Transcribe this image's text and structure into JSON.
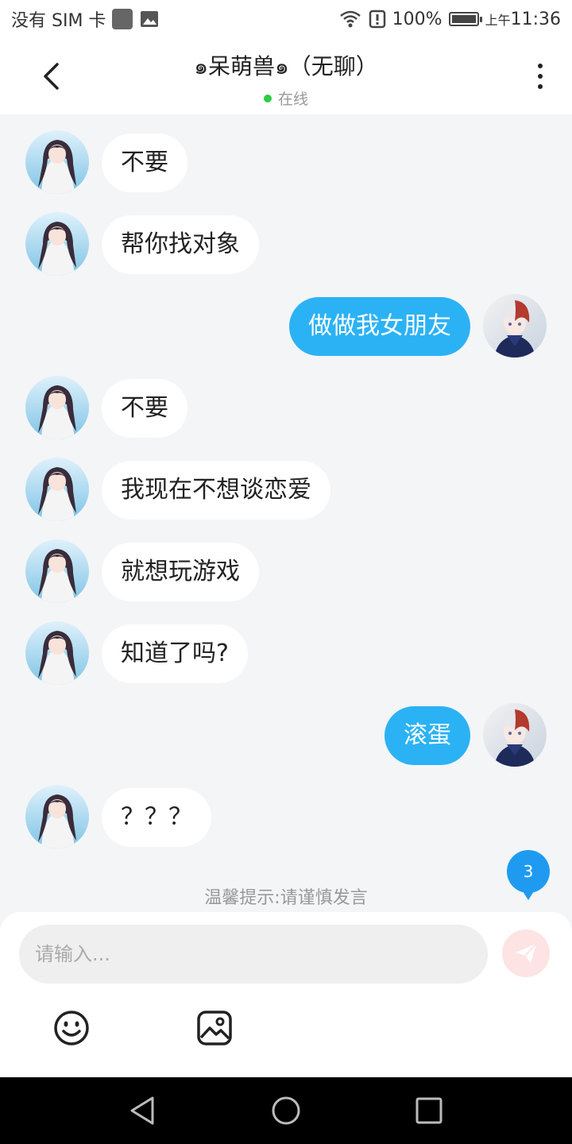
{
  "status_bar": {
    "carrier": "没有 SIM 卡",
    "battery": "100%",
    "battery_level": 1.0,
    "time_prefix": "上午",
    "time": "11:36"
  },
  "header": {
    "title": "๑呆萌兽๑（无聊）",
    "presence": "在线",
    "presence_color": "#2ecc40"
  },
  "messages": [
    {
      "side": "in",
      "text": "不要"
    },
    {
      "side": "in",
      "text": "帮你找对象"
    },
    {
      "side": "out",
      "text": "做做我女朋友"
    },
    {
      "side": "in",
      "text": "不要"
    },
    {
      "side": "in",
      "text": "我现在不想谈恋爱"
    },
    {
      "side": "in",
      "text": "就想玩游戏"
    },
    {
      "side": "in",
      "text": "知道了吗?"
    },
    {
      "side": "out",
      "text": "滚蛋"
    },
    {
      "side": "in",
      "text": "？？？"
    }
  ],
  "unread_count": "3",
  "tip": "温馨提示:请谨慎发言",
  "composer": {
    "placeholder": "请输入..."
  },
  "colors": {
    "outgoing_bubble": "#2bb2f5",
    "incoming_bubble": "#ffffff",
    "badge": "#1e9bf0",
    "background": "#f4f5f7"
  }
}
